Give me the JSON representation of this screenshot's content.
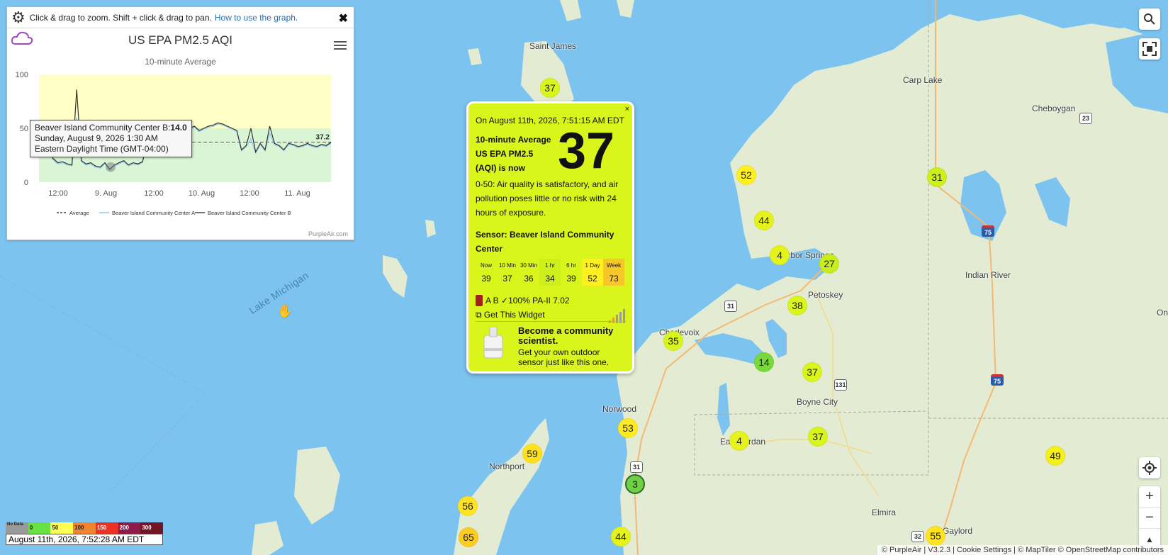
{
  "chart_panel": {
    "hint_text": "Click & drag to zoom. Shift + click & drag to pan.",
    "hint_link": "How to use the graph.",
    "close": "✖",
    "title": "US EPA PM2.5 AQI",
    "subtitle": "10-minute Average",
    "tooltip": {
      "line1_label": "Beaver Island Community Center B:",
      "line1_value": "14.0",
      "line2": "Sunday, August 9, 2026 1:30 AM",
      "line3": "Eastern Daylight Time (GMT-04:00)"
    },
    "credit": "PurpleAir.com"
  },
  "chart_data": {
    "type": "line",
    "ylim": [
      0,
      100
    ],
    "y_ticks": [
      "0",
      "50",
      "100"
    ],
    "x_ticks": [
      "12:00",
      "9. Aug",
      "12:00",
      "10. Aug",
      "12:00",
      "11. Aug"
    ],
    "bands": [
      {
        "from": 0,
        "to": 50,
        "color": "#d9f5d4"
      },
      {
        "from": 50,
        "to": 100,
        "color": "#ffffc6"
      }
    ],
    "average_value": 37.2,
    "average_label": "37.2",
    "legend": [
      "Average",
      "Beaver Island Community Center A",
      "Beaver Island Community Center B"
    ],
    "series": [
      {
        "name": "Beaver Island Community Center B",
        "values": [
          28,
          26,
          30,
          22,
          18,
          19,
          17,
          16,
          86,
          20,
          17,
          18,
          15,
          14,
          18,
          12,
          16,
          18,
          20,
          16,
          18,
          17,
          19,
          40,
          52,
          48,
          50,
          52,
          51,
          53,
          55,
          54,
          50,
          52,
          48,
          50,
          52,
          53,
          55,
          54,
          52,
          50,
          48,
          30,
          34,
          50,
          28,
          36,
          30,
          52,
          36,
          34,
          30,
          36,
          35,
          33,
          34,
          36,
          34,
          33,
          35,
          34,
          37
        ]
      },
      {
        "name": "Beaver Island Community Center A",
        "values": [
          27,
          25,
          29,
          21,
          17,
          18,
          16,
          15,
          60,
          19,
          16,
          17,
          14,
          13,
          17,
          11,
          15,
          17,
          19,
          15,
          17,
          16,
          18,
          38,
          50,
          47,
          49,
          51,
          50,
          52,
          54,
          53,
          49,
          51,
          47,
          49,
          51,
          52,
          54,
          53,
          51,
          49,
          47,
          29,
          33,
          40,
          27,
          35,
          29,
          45,
          35,
          33,
          29,
          35,
          34,
          32,
          33,
          35,
          33,
          32,
          34,
          33,
          36
        ]
      }
    ]
  },
  "popup": {
    "close": "×",
    "timestamp": "On August 11th, 2026, 7:51:15 AM EDT",
    "avg_l1": "10-minute Average",
    "avg_l2": "US EPA PM2.5",
    "avg_l3": "(AQI) is now",
    "value": "37",
    "description": "0-50: Air quality is satisfactory, and air pollution poses little or no risk with 24 hours of exposure.",
    "sensor": "Sensor: Beaver Island Community Center",
    "history": [
      {
        "label": "Now",
        "value": "39",
        "color": "#d9f51c"
      },
      {
        "label": "10 Min",
        "value": "37",
        "color": "#d9f51c"
      },
      {
        "label": "30 Min",
        "value": "36",
        "color": "#d9f51c"
      },
      {
        "label": "1 hr",
        "value": "34",
        "color": "#cdef1c"
      },
      {
        "label": "6 hr",
        "value": "39",
        "color": "#d9f51c"
      },
      {
        "label": "1 Day",
        "value": "52",
        "color": "#fff01f"
      },
      {
        "label": "Week",
        "value": "73",
        "color": "#f7c72a"
      }
    ],
    "status": "A B ✓100% PA-II 7.02",
    "widget": "Get This Widget",
    "promo_title": "Become a community scientist.",
    "promo_text": "Get your own outdoor sensor just like this one."
  },
  "map": {
    "lake_label": "Lake Michigan",
    "towns": [
      {
        "name": "Saint James"
      },
      {
        "name": "Carp Lake"
      },
      {
        "name": "Cheboygan"
      },
      {
        "name": "Harbor Springs"
      },
      {
        "name": "Petoskey"
      },
      {
        "name": "Indian River"
      },
      {
        "name": "Charlevoix"
      },
      {
        "name": "Boyne City"
      },
      {
        "name": "Norwood"
      },
      {
        "name": "East Jordan"
      },
      {
        "name": "Northport"
      },
      {
        "name": "Elmira"
      },
      {
        "name": "Gaylord"
      },
      {
        "name": "On"
      }
    ],
    "markers": [
      {
        "value": "37",
        "color": "#d9f51c"
      },
      {
        "value": "52",
        "color": "#fff01f"
      },
      {
        "value": "31",
        "color": "#cdef1c"
      },
      {
        "value": "44",
        "color": "#e6f21c"
      },
      {
        "value": "4",
        "color": "#e6f21c"
      },
      {
        "value": "27",
        "color": "#c9ee1c"
      },
      {
        "value": "38",
        "color": "#d9f51c"
      },
      {
        "value": "35",
        "color": "#d9f51c"
      },
      {
        "value": "14",
        "color": "#79d83a"
      },
      {
        "value": "37",
        "color": "#d9f51c"
      },
      {
        "value": "53",
        "color": "#ffea1f"
      },
      {
        "value": "4",
        "color": "#e6f21c"
      },
      {
        "value": "37",
        "color": "#d9f51c"
      },
      {
        "value": "49",
        "color": "#f5ef1c"
      },
      {
        "value": "59",
        "color": "#ffe11f"
      },
      {
        "value": "3",
        "color": "#6fcf45"
      },
      {
        "value": "56",
        "color": "#ffe41f"
      },
      {
        "value": "65",
        "color": "#fbcd22"
      },
      {
        "value": "44",
        "color": "#e6f21c"
      },
      {
        "value": "55",
        "color": "#ffe41f"
      }
    ],
    "shields": [
      {
        "text": "23"
      },
      {
        "text": "75"
      },
      {
        "text": "31"
      },
      {
        "text": "131"
      },
      {
        "text": "75"
      },
      {
        "text": "31"
      },
      {
        "text": "32"
      }
    ]
  },
  "legend": {
    "labels": [
      "No Data",
      "0",
      "50",
      "100",
      "150",
      "200",
      "300"
    ],
    "colors": [
      "#999999",
      "#68e143",
      "#ffff55",
      "#ef8533",
      "#ea3324",
      "#8c1a4b",
      "#731425"
    ],
    "time": "August 11th, 2026, 7:52:28 AM EDT"
  },
  "attribution": "© PurpleAir | V3.2.3 | Cookie Settings | © MapTiler © OpenStreetMap contributors"
}
